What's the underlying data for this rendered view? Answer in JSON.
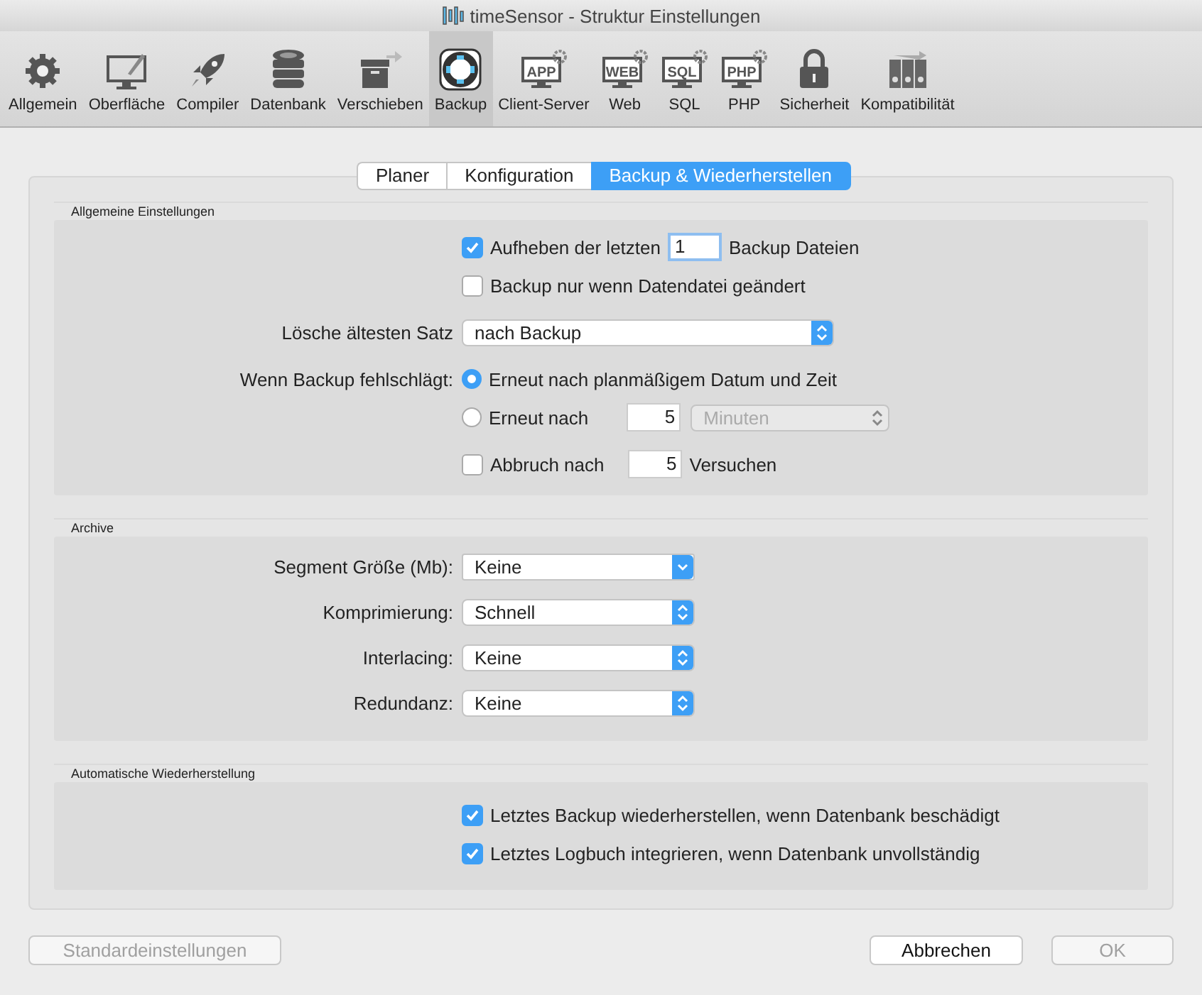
{
  "window": {
    "title": "timeSensor - Struktur Einstellungen"
  },
  "toolbar": [
    {
      "label": "Allgemein",
      "kind": "gear",
      "selected": false
    },
    {
      "label": "Oberfläche",
      "kind": "monitor",
      "selected": false
    },
    {
      "label": "Compiler",
      "kind": "rocket",
      "selected": false
    },
    {
      "label": "Datenbank",
      "kind": "database",
      "selected": false
    },
    {
      "label": "Verschieben",
      "kind": "box",
      "selected": false
    },
    {
      "label": "Backup",
      "kind": "lifebuoy",
      "selected": true
    },
    {
      "label": "Client-Server",
      "kind": "badge",
      "badge": "APP",
      "selected": false
    },
    {
      "label": "Web",
      "kind": "badge",
      "badge": "WEB",
      "selected": false
    },
    {
      "label": "SQL",
      "kind": "badge",
      "badge": "SQL",
      "selected": false
    },
    {
      "label": "PHP",
      "kind": "badge",
      "badge": "PHP",
      "selected": false
    },
    {
      "label": "Sicherheit",
      "kind": "lock",
      "selected": false
    },
    {
      "label": "Kompatibilität",
      "kind": "binders",
      "selected": false
    }
  ],
  "tabs": [
    {
      "label": "Planer",
      "selected": false
    },
    {
      "label": "Konfiguration",
      "selected": false
    },
    {
      "label": "Backup & Wiederherstellen",
      "selected": true
    }
  ],
  "general": {
    "title": "Allgemeine Einstellungen",
    "keep": {
      "checked": true,
      "label": "Aufheben der letzten",
      "value": "1",
      "suffix": "Backup Dateien"
    },
    "only_changed": {
      "checked": false,
      "label": "Backup nur wenn Datendatei geändert"
    },
    "delete_oldest": {
      "label": "Lösche ältesten Satz",
      "value": "nach Backup"
    },
    "on_failure": {
      "label": "Wenn Backup fehlschlägt:",
      "options": [
        {
          "label": "Erneut nach planmäßigem Datum und Zeit",
          "selected": true
        },
        {
          "label": "Erneut nach",
          "selected": false,
          "value": "5",
          "unit": "Minuten"
        }
      ]
    },
    "abort": {
      "checked": false,
      "label": "Abbruch nach",
      "value": "5",
      "suffix": "Versuchen"
    }
  },
  "archive": {
    "title": "Archive",
    "fields": [
      {
        "label": "Segment Größe (Mb):",
        "value": "Keine",
        "kind": "combo"
      },
      {
        "label": "Komprimierung:",
        "value": "Schnell",
        "kind": "popup"
      },
      {
        "label": "Interlacing:",
        "value": "Keine",
        "kind": "popup"
      },
      {
        "label": "Redundanz:",
        "value": "Keine",
        "kind": "popup"
      }
    ]
  },
  "auto_restore": {
    "title": "Automatische Wiederherstellung",
    "options": [
      {
        "label": "Letztes Backup wiederherstellen, wenn Datenbank beschädigt",
        "checked": true
      },
      {
        "label": "Letztes Logbuch integrieren, wenn Datenbank unvollständig",
        "checked": true
      }
    ]
  },
  "buttons": [
    {
      "label": "Standardeinstellungen",
      "disabled": true
    },
    {
      "label": "Abbrechen",
      "disabled": false
    },
    {
      "label": "OK",
      "disabled": true
    }
  ]
}
